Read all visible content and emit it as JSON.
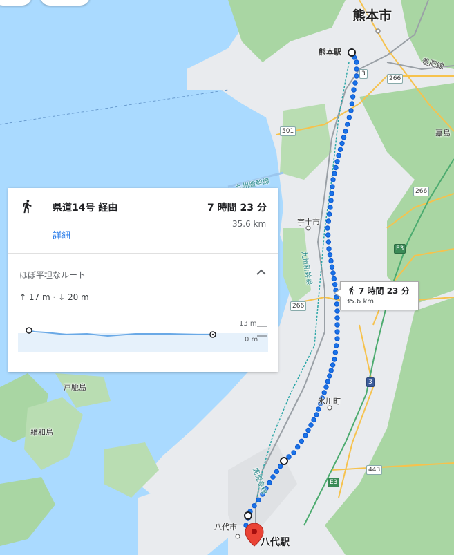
{
  "map": {
    "labels": {
      "kumamoto_city": "熊本市",
      "kumamoto_station": "熊本駅",
      "uto_city": "宇土市",
      "hikawa_town": "氷川町",
      "yatsushiro_city": "八代市",
      "yatsushiro_station": "八代駅",
      "kashima": "嘉島",
      "toroshima": "戸馳島",
      "ibashima": "維和島",
      "houhi_line": "豊肥線",
      "kyushu_shinkansen_1": "九州新幹線",
      "kyushu_shinkansen_2": "九州新幹線",
      "kagoshima_line": "鹿児島線"
    },
    "road_shields": {
      "r3a": "3",
      "r266a": "266",
      "r501": "501",
      "r266b": "266",
      "r266c": "266",
      "e3a": "E3",
      "r3b": "3",
      "r443": "443",
      "e3b": "E3"
    },
    "colors": {
      "water": "#aadaff",
      "land": "#e8eaed",
      "forest": "#a8d5a2",
      "route": "#1a73e8",
      "destination_pin": "#ea4335"
    }
  },
  "panel": {
    "route_name": "県道14号 経由",
    "duration": "7 時間 23 分",
    "distance": "35.6 km",
    "details_link": "詳細",
    "terrain_title": "ほぼ平坦なルート",
    "elevation_summary": "↑ 17 m · ↓ 20 m",
    "elevation_max_label": "13 m",
    "elevation_min_label": "0 m"
  },
  "callout": {
    "duration": "7 時間 23 分",
    "distance": "35.6 km"
  },
  "icons": {
    "walk": "walk-icon",
    "collapse": "chevron-up-icon",
    "pin": "map-pin-icon"
  }
}
